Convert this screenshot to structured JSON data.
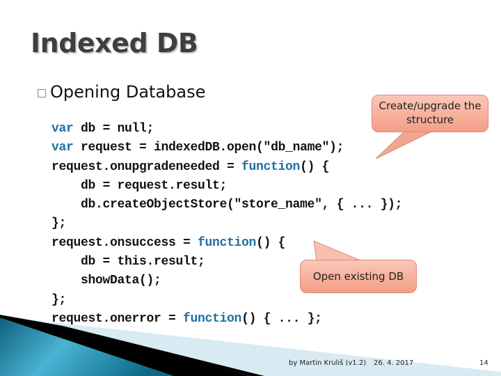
{
  "slide": {
    "title": "Indexed DB",
    "bullet_icon": "square-bullet-icon",
    "bullet": "Opening Database",
    "code_lines": [
      [
        {
          "t": "var",
          "kw": true
        },
        {
          "t": " db = null;"
        }
      ],
      [
        {
          "t": "var",
          "kw": true
        },
        {
          "t": " request = indexedDB.open(\"db_name\");"
        }
      ],
      [
        {
          "t": "request.onupgradeneeded = "
        },
        {
          "t": "function",
          "kw": true
        },
        {
          "t": "() {"
        }
      ],
      [
        {
          "t": "    db = request.result;"
        }
      ],
      [
        {
          "t": "    db.createObjectStore(\"store_name\", { ... });"
        }
      ],
      [
        {
          "t": "};"
        }
      ],
      [
        {
          "t": "request.onsuccess = "
        },
        {
          "t": "function",
          "kw": true
        },
        {
          "t": "() {"
        }
      ],
      [
        {
          "t": "    db = this.result;"
        }
      ],
      [
        {
          "t": "    showData();"
        }
      ],
      [
        {
          "t": "};"
        }
      ],
      [
        {
          "t": "request.onerror = "
        },
        {
          "t": "function",
          "kw": true
        },
        {
          "t": "() { ... };"
        }
      ]
    ],
    "callouts": {
      "upgrade": "Create/upgrade the structure",
      "success": "Open existing DB"
    },
    "footer": {
      "author": "by Martin Kruliš (v1.2)",
      "date": "26. 4. 2017",
      "page": "14"
    },
    "colors": {
      "keyword": "#1f6fa3",
      "callout": "#f7b4a0",
      "accent": "#1a7fa0"
    }
  }
}
